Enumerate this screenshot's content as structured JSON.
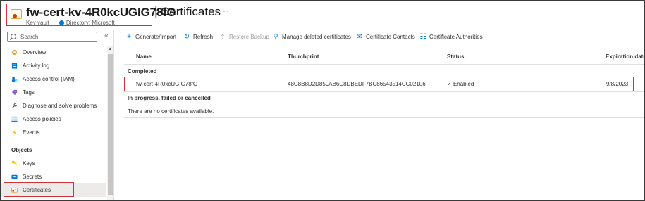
{
  "header": {
    "resource_name": "fw-cert-kv-4R0kcUGIG78fG",
    "resource_type": "Key vault",
    "directory": "Directory: Microsoft",
    "separator": "|",
    "page_title": "Certificates",
    "more": "···"
  },
  "sidebar": {
    "search_placeholder": "Search",
    "collapse": "«",
    "items": [
      {
        "label": "Overview",
        "icon": "key-vault-icon"
      },
      {
        "label": "Activity log",
        "icon": "activity-log-icon"
      },
      {
        "label": "Access control (IAM)",
        "icon": "iam-icon"
      },
      {
        "label": "Tags",
        "icon": "tag-icon"
      },
      {
        "label": "Diagnose and solve problems",
        "icon": "wrench-icon"
      },
      {
        "label": "Access policies",
        "icon": "list-icon"
      },
      {
        "label": "Events",
        "icon": "lightning-icon"
      }
    ],
    "section_objects": "Objects",
    "object_items": [
      {
        "label": "Keys",
        "icon": "key-icon"
      },
      {
        "label": "Secrets",
        "icon": "secret-icon"
      },
      {
        "label": "Certificates",
        "icon": "certificate-icon",
        "active": true
      }
    ]
  },
  "toolbar": {
    "generate_import": "Generate/Import",
    "refresh": "Refresh",
    "restore_backup": "Restore Backup",
    "manage_deleted": "Manage deleted certificates",
    "contacts": "Certificate Contacts",
    "authorities": "Certificate Authorities"
  },
  "table": {
    "columns": [
      "Name",
      "Thumbprint",
      "Status",
      "Expiration date"
    ],
    "group_completed": "Completed",
    "rows": [
      {
        "name": "fw-cert-4R0kcUGIG78fG",
        "thumbprint": "48C8B8D2D859AB6C8DBEDF7BC86543514CC02106",
        "status": "Enabled",
        "expiration": "9/8/2023"
      }
    ],
    "group_in_progress": "In progress, failed or cancelled",
    "empty_message": "There are no certificates available."
  },
  "colors": {
    "accent": "#0078d4",
    "highlight_box": "#d13438",
    "active_nav": "#edebe9"
  }
}
